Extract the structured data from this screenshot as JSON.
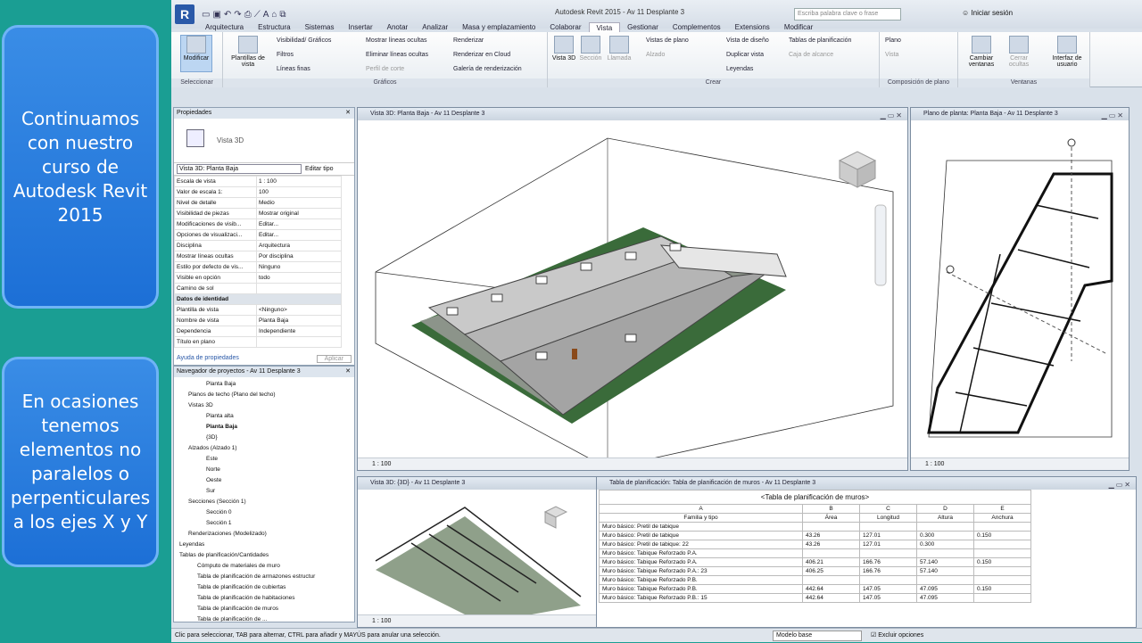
{
  "overlay": {
    "top_text": "Continuamos con nuestro curso de Autodesk Revit 2015",
    "bottom_text": "En ocasiones tenemos elementos no paralelos o perpenticulares a los ejes X y Y"
  },
  "app": {
    "logo": "R",
    "title": "Autodesk Revit 2015   -   Av 11 Desplante 3",
    "search_placeholder": "Escriba palabra clave o frase",
    "signin": "Iniciar sesión"
  },
  "tabs": [
    "Arquitectura",
    "Estructura",
    "Sistemas",
    "Insertar",
    "Anotar",
    "Analizar",
    "Masa y emplazamiento",
    "Colaborar",
    "Vista",
    "Gestionar",
    "Complementos",
    "Extensions",
    "Modificar"
  ],
  "active_tab": "Vista",
  "ribbon": {
    "modificar": "Modificar",
    "seleccionar": "Seleccionar",
    "plantillas": "Plantillas de vista",
    "graficos_items": [
      "Visibilidad/ Gráficos",
      "Filtros",
      "Líneas finas",
      "Mostrar líneas ocultas",
      "Eliminar líneas ocultas",
      "Perfil de corte",
      "Renderizar",
      "Renderizar en Cloud",
      "Galería de renderización"
    ],
    "graficos_label": "Gráficos",
    "crear_big": [
      "Vista 3D",
      "Sección",
      "Llamada"
    ],
    "crear_items": [
      "Vistas de plano",
      "Alzado",
      "Vista de diseño",
      "Duplicar vista",
      "Leyendas",
      "Tablas de planificación",
      "Caja de alcance"
    ],
    "crear_label": "Crear",
    "comp_items": [
      "Plano",
      "Vista"
    ],
    "comp_label": "Composición de plano",
    "ventanas_items": [
      "Cambiar ventanas",
      "Cerrar ocultas",
      "Interfaz de usuario"
    ],
    "ventanas_label": "Ventanas"
  },
  "properties": {
    "title": "Propiedades",
    "type_name": "Vista 3D",
    "selector": "Vista 3D: Planta Baja",
    "edit_type": "Editar tipo",
    "rows": [
      [
        "Escala de vista",
        "1 : 100"
      ],
      [
        "Valor de escala   1:",
        "100"
      ],
      [
        "Nivel de detalle",
        "Medio"
      ],
      [
        "Visibilidad de piezas",
        "Mostrar original"
      ],
      [
        "Modificaciones de visib...",
        "Editar..."
      ],
      [
        "Opciones de visualizaci...",
        "Editar..."
      ],
      [
        "Disciplina",
        "Arquitectura"
      ],
      [
        "Mostrar líneas ocultas",
        "Por disciplina"
      ],
      [
        "Estilo por defecto de vis...",
        "Ninguno"
      ],
      [
        "Visible en opción",
        "todo"
      ],
      [
        "Camino de sol",
        ""
      ]
    ],
    "section": "Datos de identidad",
    "rows2": [
      [
        "Plantilla de vista",
        "<Ninguno>"
      ],
      [
        "Nombre de vista",
        "Planta Baja"
      ],
      [
        "Dependencia",
        "Independiente"
      ],
      [
        "Título en plano",
        ""
      ]
    ],
    "help": "Ayuda de propiedades",
    "apply": "Aplicar"
  },
  "browser": {
    "title": "Navegador de proyectos - Av 11 Desplante 3",
    "nodes": [
      {
        "t": "Planta Baja",
        "i": 3
      },
      {
        "t": "Planos de techo (Plano del techo)",
        "i": 1
      },
      {
        "t": "Vistas 3D",
        "i": 1
      },
      {
        "t": "Planta alta",
        "i": 3
      },
      {
        "t": "Planta Baja",
        "i": 3,
        "b": true
      },
      {
        "t": "{3D}",
        "i": 3
      },
      {
        "t": "Alzados (Alzado 1)",
        "i": 1
      },
      {
        "t": "Este",
        "i": 3
      },
      {
        "t": "Norte",
        "i": 3
      },
      {
        "t": "Oeste",
        "i": 3
      },
      {
        "t": "Sur",
        "i": 3
      },
      {
        "t": "Secciones (Sección 1)",
        "i": 1
      },
      {
        "t": "Sección 0",
        "i": 3
      },
      {
        "t": "Sección 1",
        "i": 3
      },
      {
        "t": "Renderizaciones (Modelizado)",
        "i": 1
      },
      {
        "t": "Leyendas",
        "i": 0
      },
      {
        "t": "Tablas de planificación/Cantidades",
        "i": 0
      },
      {
        "t": "Cómputo de materiales de muro",
        "i": 2
      },
      {
        "t": "Tabla de planificación de armazones estructur",
        "i": 2
      },
      {
        "t": "Tabla de planificación de cubiertas",
        "i": 2
      },
      {
        "t": "Tabla de planificación de habitaciones",
        "i": 2
      },
      {
        "t": "Tabla de planificación de muros",
        "i": 2
      },
      {
        "t": "Tabla de planificación de ...",
        "i": 2
      }
    ]
  },
  "views": {
    "v3d_title": "Vista 3D: Planta Baja - Av 11 Desplante 3",
    "plan_title": "Plano de planta: Planta Baja - Av 11 Desplante 3",
    "v3d2_title": "Vista 3D: {3D} - Av 11 Desplante 3",
    "sched_title": "Tabla de planificación: Tabla de planificación de muros - Av 11 Desplante 3",
    "scale": "1 : 100"
  },
  "schedule": {
    "title": "<Tabla de planificación de muros>",
    "letters": [
      "A",
      "B",
      "C",
      "D",
      "E"
    ],
    "headers": [
      "Familia y tipo",
      "Área",
      "Longitud",
      "Altura",
      "Anchura"
    ],
    "rows": [
      [
        "Muro básico: Pretil de tabique",
        "",
        "",
        "",
        ""
      ],
      [
        "Muro básico: Pretil de tabique",
        "43.26",
        "127.01",
        "0.300",
        "0.150"
      ],
      [
        "Muro básico: Pretil de tabique: 22",
        "43.26",
        "127.01",
        "0.300",
        ""
      ],
      [
        "Muro básico: Tabique Reforzado P.A.",
        "",
        "",
        "",
        ""
      ],
      [
        "Muro básico: Tabique Reforzado P.A.",
        "406.21",
        "166.76",
        "57.140",
        "0.150"
      ],
      [
        "Muro básico: Tabique Reforzado P.A.: 23",
        "406.25",
        "166.76",
        "57.140",
        ""
      ],
      [
        "Muro básico: Tabique Reforzado P.B.",
        "",
        "",
        "",
        ""
      ],
      [
        "Muro básico: Tabique Reforzado P.B.",
        "442.64",
        "147.05",
        "47.095",
        "0.150"
      ],
      [
        "Muro básico: Tabique Reforzado P.B.: 15",
        "442.64",
        "147.05",
        "47.095",
        ""
      ]
    ]
  },
  "status": {
    "text": "Clic para seleccionar, TAB para alternar, CTRL para añadir y MAYÚS para anular una selección.",
    "model": "Modelo base",
    "options": "Excluir opciones"
  }
}
